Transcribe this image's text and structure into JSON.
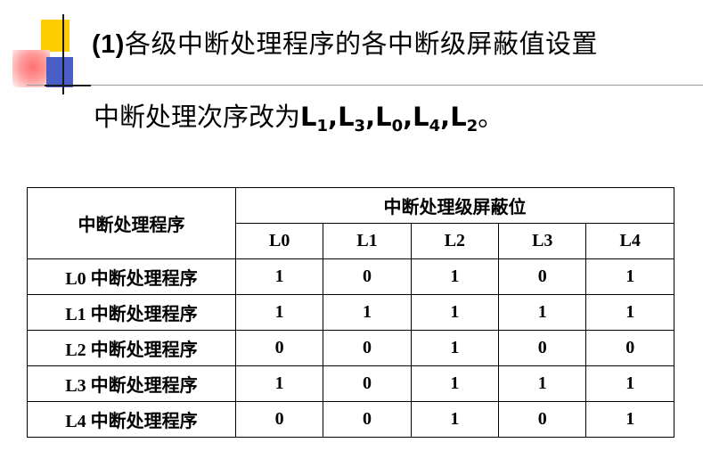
{
  "title": {
    "prefix": "(1)",
    "text": "各级中断处理程序的各中断级屏蔽值设置"
  },
  "subtitle": {
    "text": "中断处理次序改为",
    "sequence": [
      {
        "letter": "L",
        "index": "1",
        "sep": ","
      },
      {
        "letter": "L",
        "index": "3",
        "sep": ","
      },
      {
        "letter": "L",
        "index": "0",
        "sep": ","
      },
      {
        "letter": "L",
        "index": "4",
        "sep": ","
      },
      {
        "letter": "L",
        "index": "2",
        "sep": ""
      }
    ],
    "end": "。"
  },
  "table": {
    "row_header": "中断处理程序",
    "group_header": "中断处理级屏蔽位",
    "columns": [
      "L0",
      "L1",
      "L2",
      "L3",
      "L4"
    ],
    "rows": [
      {
        "label": "L0 中断处理程序",
        "values": [
          "1",
          "0",
          "1",
          "0",
          "1"
        ]
      },
      {
        "label": "L1 中断处理程序",
        "values": [
          "1",
          "1",
          "1",
          "1",
          "1"
        ]
      },
      {
        "label": "L2 中断处理程序",
        "values": [
          "0",
          "0",
          "1",
          "0",
          "0"
        ]
      },
      {
        "label": "L3 中断处理程序",
        "values": [
          "1",
          "0",
          "1",
          "1",
          "1"
        ]
      },
      {
        "label": "L4 中断处理程序",
        "values": [
          "0",
          "0",
          "1",
          "0",
          "1"
        ]
      }
    ]
  }
}
